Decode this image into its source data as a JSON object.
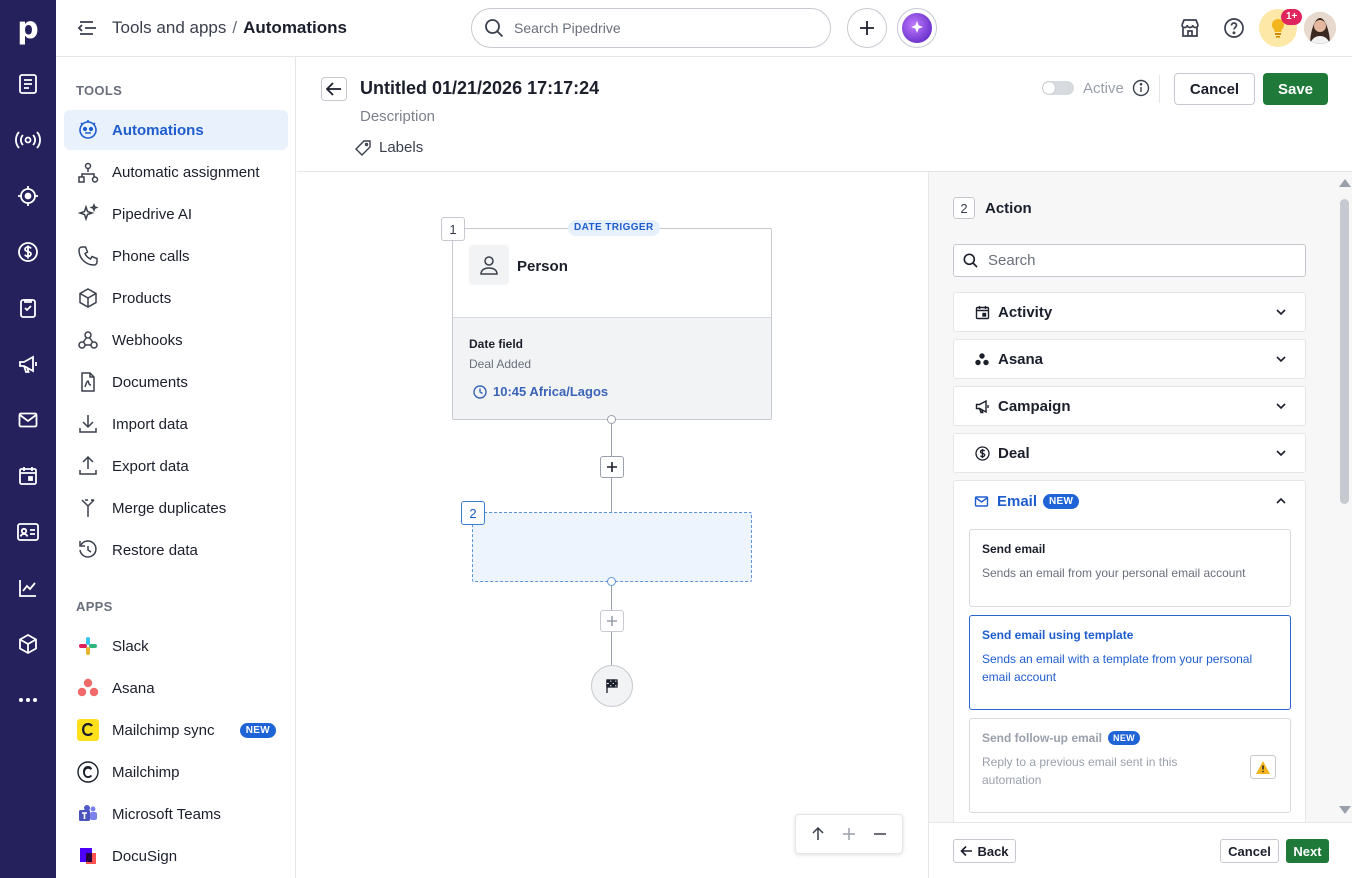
{
  "app": {
    "logo_letter": "p",
    "accent": "#1f5dcf",
    "rail_color": "#25215c",
    "save_color": "#1f7a3a"
  },
  "rail": {
    "icons": [
      "leads-icon",
      "campaigns-broadcast-icon",
      "focus-target-icon",
      "deals-dollar-icon",
      "tasks-clipboard-icon",
      "megaphone-icon",
      "mail-icon",
      "calendar-icon",
      "contacts-card-icon",
      "insights-chart-icon",
      "products-box-icon",
      "more-dots-icon"
    ]
  },
  "header": {
    "breadcrumb_parent": "Tools and apps",
    "breadcrumb_sep": "/",
    "breadcrumb_current": "Automations",
    "search_placeholder": "Search Pipedrive",
    "notification_badge": "1+"
  },
  "tools": {
    "section_title": "TOOLS",
    "items": [
      {
        "label": "Automations",
        "icon": "automation-robot-icon"
      },
      {
        "label": "Automatic assignment",
        "icon": "assignment-tree-icon"
      },
      {
        "label": "Pipedrive AI",
        "icon": "sparkles-icon"
      },
      {
        "label": "Phone calls",
        "icon": "phone-icon"
      },
      {
        "label": "Products",
        "icon": "box-icon"
      },
      {
        "label": "Webhooks",
        "icon": "webhook-icon"
      },
      {
        "label": "Documents",
        "icon": "document-icon"
      },
      {
        "label": "Import data",
        "icon": "import-icon"
      },
      {
        "label": "Export data",
        "icon": "export-icon"
      },
      {
        "label": "Merge duplicates",
        "icon": "merge-icon"
      },
      {
        "label": "Restore data",
        "icon": "restore-icon"
      }
    ]
  },
  "apps": {
    "section_title": "APPS",
    "items": [
      {
        "label": "Slack",
        "icon": "slack-logo-icon"
      },
      {
        "label": "Asana",
        "icon": "asana-logo-icon"
      },
      {
        "label": "Mailchimp sync",
        "icon": "mailchimp-logo-icon",
        "badge": "NEW"
      },
      {
        "label": "Mailchimp",
        "icon": "mailchimp-logo-icon"
      },
      {
        "label": "Microsoft Teams",
        "icon": "teams-logo-icon"
      },
      {
        "label": "DocuSign",
        "icon": "docusign-logo-icon"
      }
    ]
  },
  "editor": {
    "title": "Untitled 01/21/2026 17:17:24",
    "description_placeholder": "Description",
    "labels_label": "Labels",
    "active_label": "Active",
    "active_on": false,
    "cancel_label": "Cancel",
    "save_label": "Save"
  },
  "flow": {
    "trigger": {
      "step_number": "1",
      "tag": "DATE TRIGGER",
      "entity": "Person",
      "field_title": "Date field",
      "field_value": "Deal Added",
      "time": "10:45 Africa/Lagos"
    },
    "action": {
      "step_number": "2"
    }
  },
  "panel": {
    "step_number": "2",
    "title": "Action",
    "search_placeholder": "Search",
    "categories": [
      {
        "label": "Activity",
        "icon": "calendar-icon"
      },
      {
        "label": "Asana",
        "icon": "asana-dots-icon"
      },
      {
        "label": "Campaign",
        "icon": "megaphone-icon"
      },
      {
        "label": "Deal",
        "icon": "dollar-circle-icon"
      }
    ],
    "open_category": {
      "label": "Email",
      "badge": "NEW",
      "options": [
        {
          "title": "Send email",
          "desc": "Sends an email from your personal email account"
        },
        {
          "title": "Send email using template",
          "desc": "Sends an email with a template from your personal email account"
        },
        {
          "title": "Send follow-up email",
          "badge": "NEW",
          "desc": "Reply to a previous email sent in this automation"
        }
      ]
    },
    "back_label": "Back",
    "cancel_label": "Cancel",
    "next_label": "Next"
  }
}
